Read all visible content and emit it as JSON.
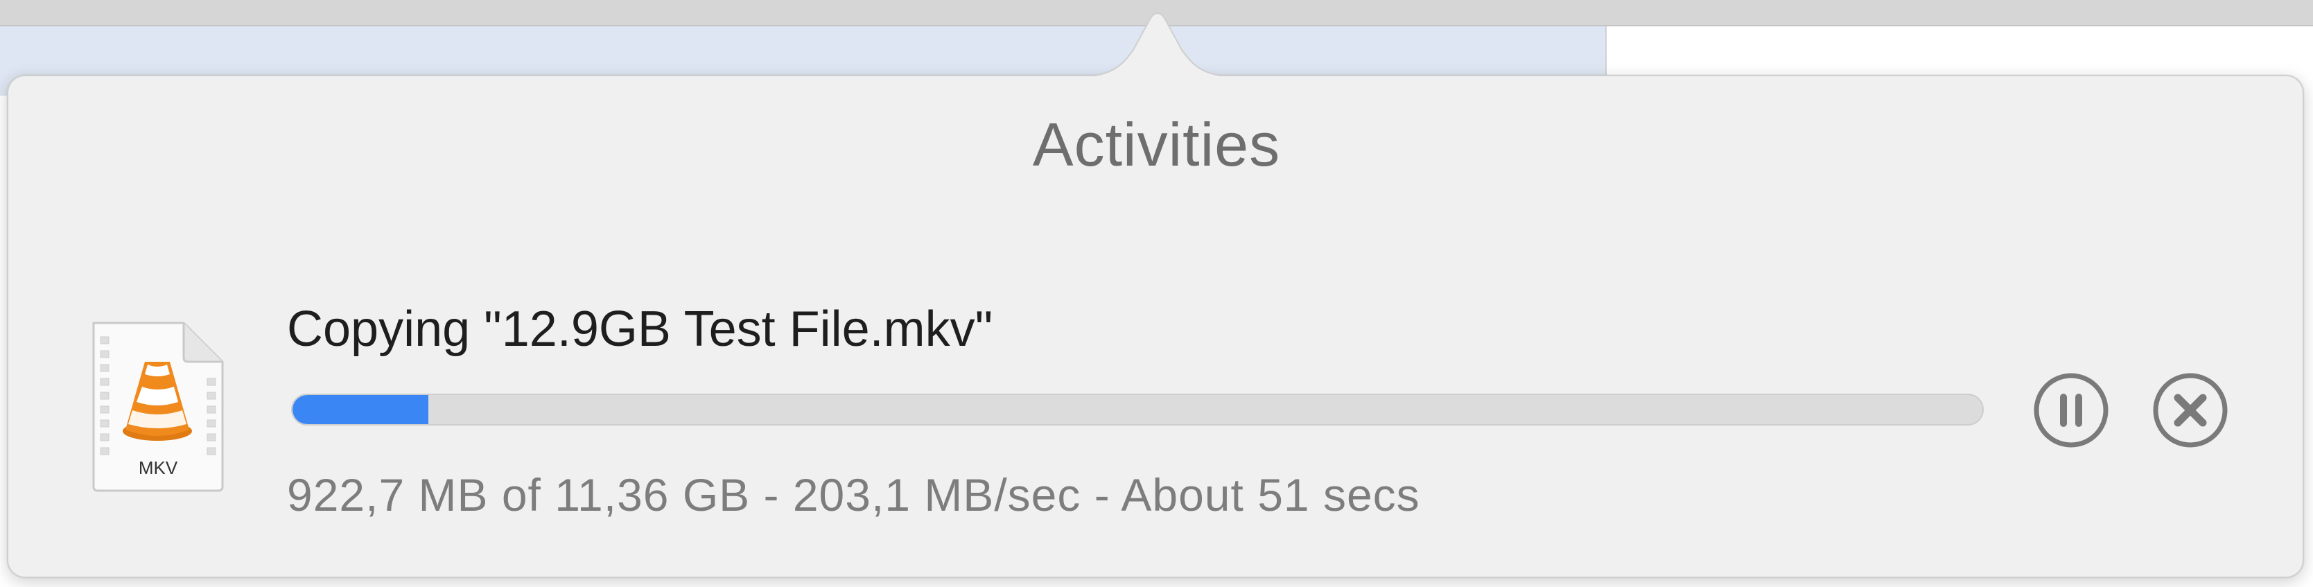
{
  "popover": {
    "title": "Activities"
  },
  "activity": {
    "file_icon": {
      "icon": "vlc-cone-file-icon",
      "type_label": "MKV"
    },
    "name": "Copying \"12.9GB Test File.mkv\"",
    "progress": 0.0805,
    "status": "922,7 MB of 11,36 GB - 203,1 MB/sec - About 51 secs",
    "controls": {
      "pause_icon": "pause-circle-icon",
      "cancel_icon": "close-circle-icon"
    }
  },
  "colors": {
    "accent": "#3b86f5",
    "cone_orange": "#f08a1c",
    "popover_bg": "#f0f0f0",
    "title_text": "#6e6e6e",
    "status_text": "#7d7d7d"
  }
}
